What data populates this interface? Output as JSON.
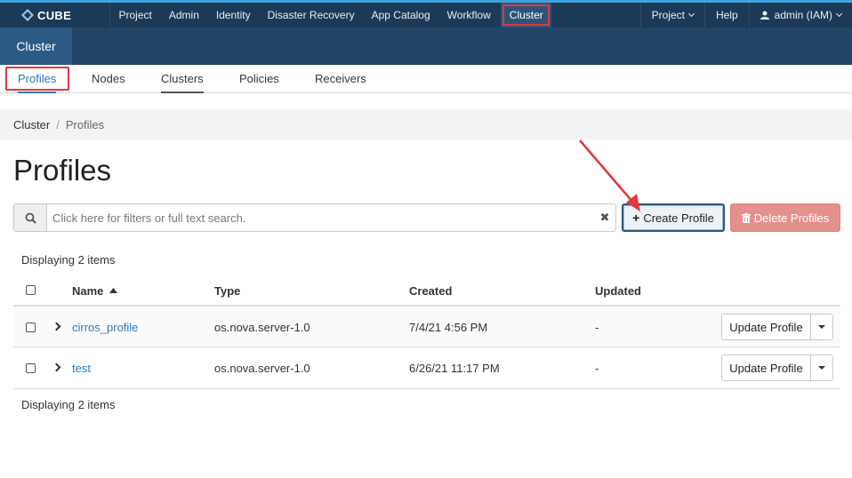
{
  "brand": {
    "name": "CUBE"
  },
  "topnav": {
    "items": [
      "Project",
      "Admin",
      "Identity",
      "Disaster Recovery",
      "App Catalog",
      "Workflow",
      "Cluster"
    ],
    "right": {
      "project": "Project",
      "help": "Help",
      "user": "admin (IAM)"
    }
  },
  "section": {
    "title": "Cluster"
  },
  "subtabs": [
    "Profiles",
    "Nodes",
    "Clusters",
    "Policies",
    "Receivers"
  ],
  "breadcrumb": {
    "parent": "Cluster",
    "separator": "/",
    "current": "Profiles"
  },
  "page": {
    "title": "Profiles"
  },
  "search": {
    "placeholder": "Click here for filters or full text search.",
    "value": ""
  },
  "actions": {
    "create": "Create Profile",
    "delete": "Delete Profiles"
  },
  "table": {
    "count_top": "Displaying 2 items",
    "count_bottom": "Displaying 2 items",
    "columns": [
      "Name",
      "Type",
      "Created",
      "Updated"
    ],
    "rows": [
      {
        "name": "cirros_profile",
        "type": "os.nova.server-1.0",
        "created": "7/4/21 4:56 PM",
        "updated": "-",
        "action": "Update Profile"
      },
      {
        "name": "test",
        "type": "os.nova.server-1.0",
        "created": "6/26/21 11:17 PM",
        "updated": "-",
        "action": "Update Profile"
      }
    ]
  },
  "colors": {
    "topbar": "#1c3a57",
    "secbar": "#224567",
    "link": "#2a7ab8",
    "highlight": "#e0383e",
    "danger": "#e4908c"
  }
}
